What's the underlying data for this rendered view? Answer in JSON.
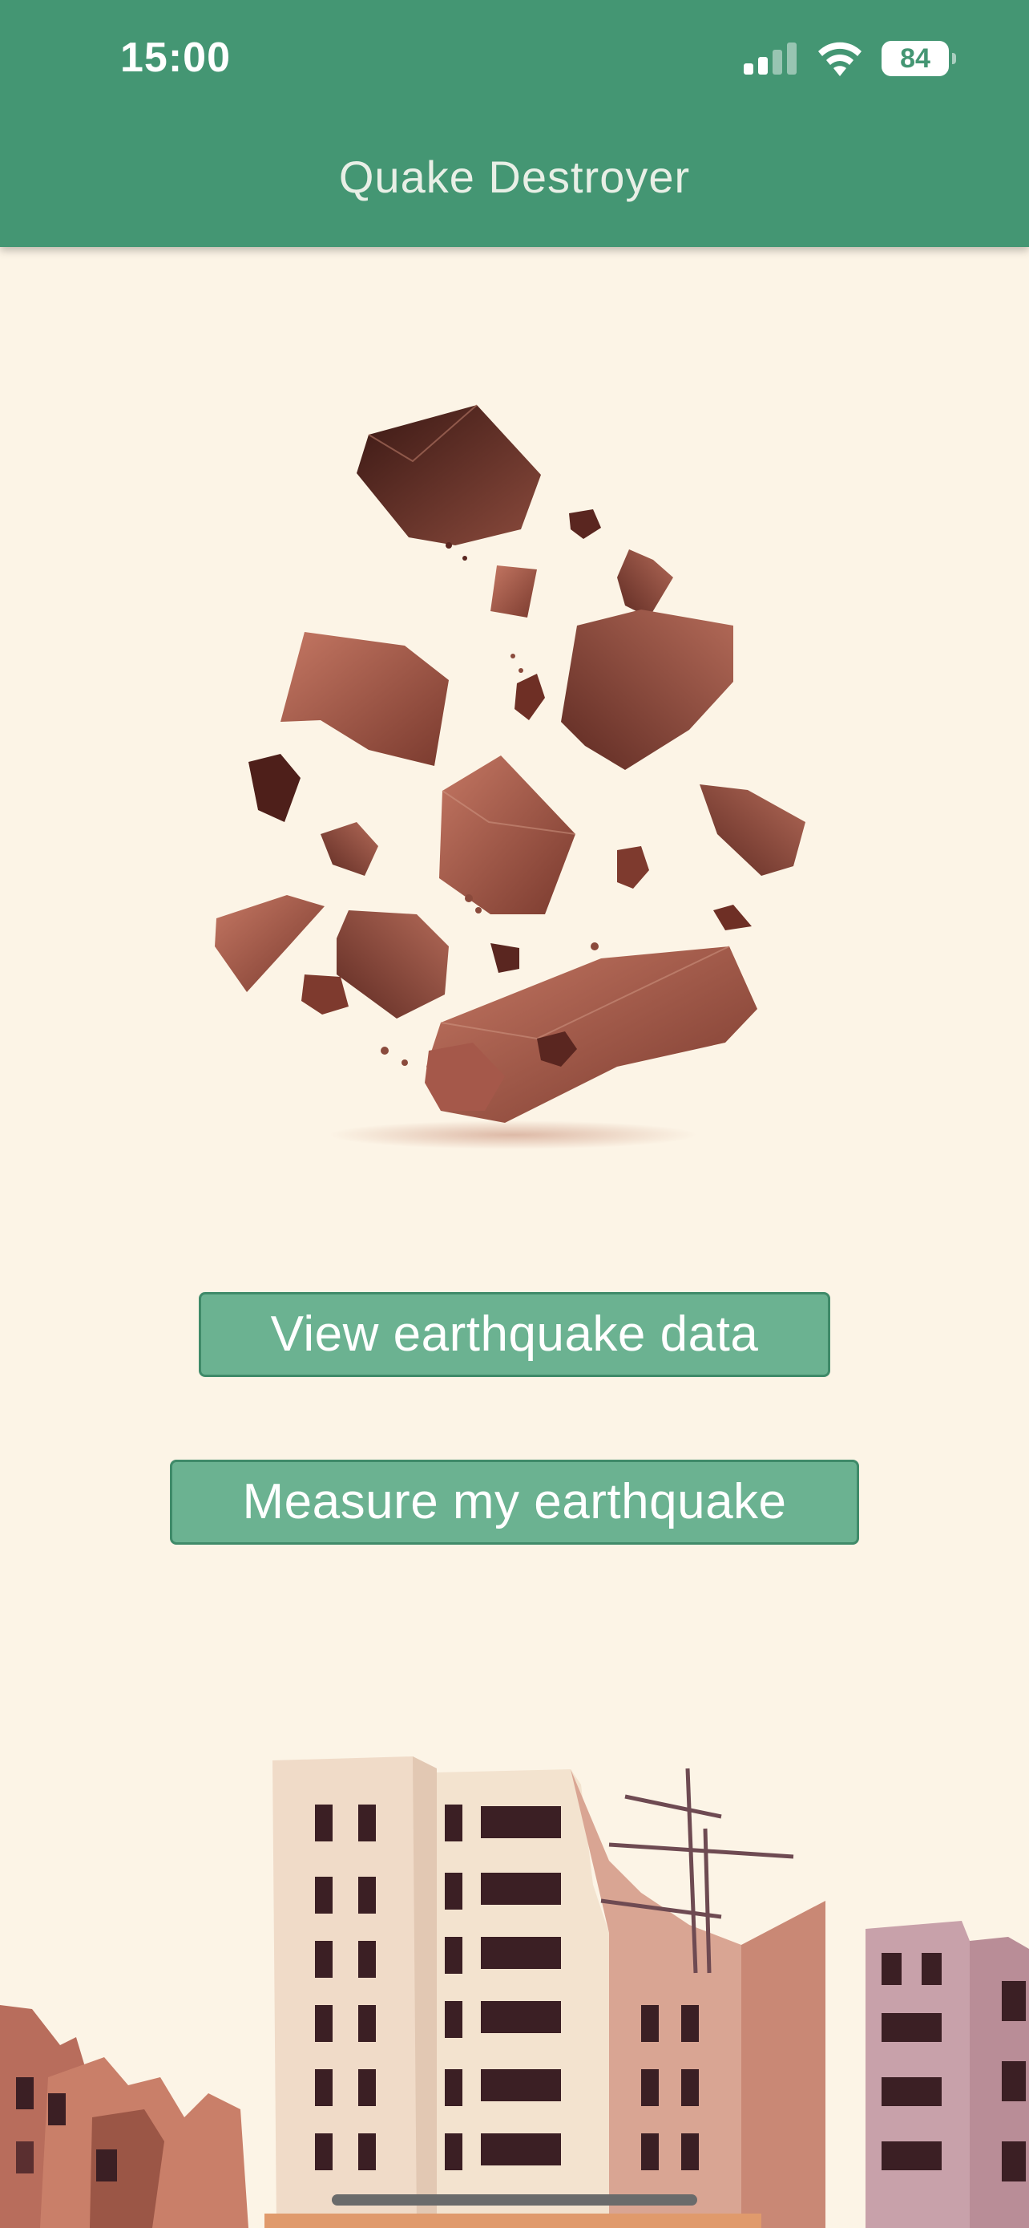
{
  "status_bar": {
    "time": "15:00",
    "battery": "84",
    "icons": [
      "cellular-signal-icon",
      "wifi-icon",
      "battery-icon"
    ]
  },
  "header": {
    "title": "Quake Destroyer"
  },
  "buttons": {
    "view_data": "View earthquake data",
    "measure": "Measure my earthquake"
  },
  "illustrations": {
    "hero": "falling-rocks-illustration",
    "footer": "ruined-buildings-illustration"
  },
  "colors": {
    "header": "#449673",
    "background": "#fcf4e6",
    "button": "#6bb291",
    "button_border": "#3f8a69",
    "rock": "#9a4c3c"
  }
}
